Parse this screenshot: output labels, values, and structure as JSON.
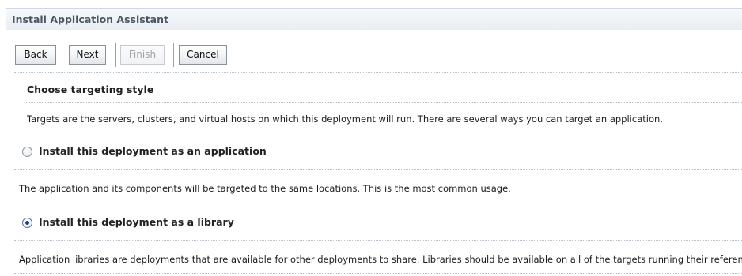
{
  "assistant": {
    "title": "Install Application Assistant"
  },
  "toolbar": {
    "back_label": "Back",
    "next_label": "Next",
    "finish_label": "Finish",
    "cancel_label": "Cancel"
  },
  "section": {
    "heading": "Choose targeting style",
    "description": "Targets are the servers, clusters, and virtual hosts on which this deployment will run. There are several ways you can target an application."
  },
  "options": [
    {
      "label": "Install this deployment as an application",
      "description": "The application and its components will be targeted to the same locations. This is the most common usage.",
      "selected": false
    },
    {
      "label": "Install this deployment as a library",
      "description": "Application libraries are deployments that are available for other deployments to share. Libraries should be available on all of the targets running their referencing applications.",
      "selected": true
    }
  ]
}
